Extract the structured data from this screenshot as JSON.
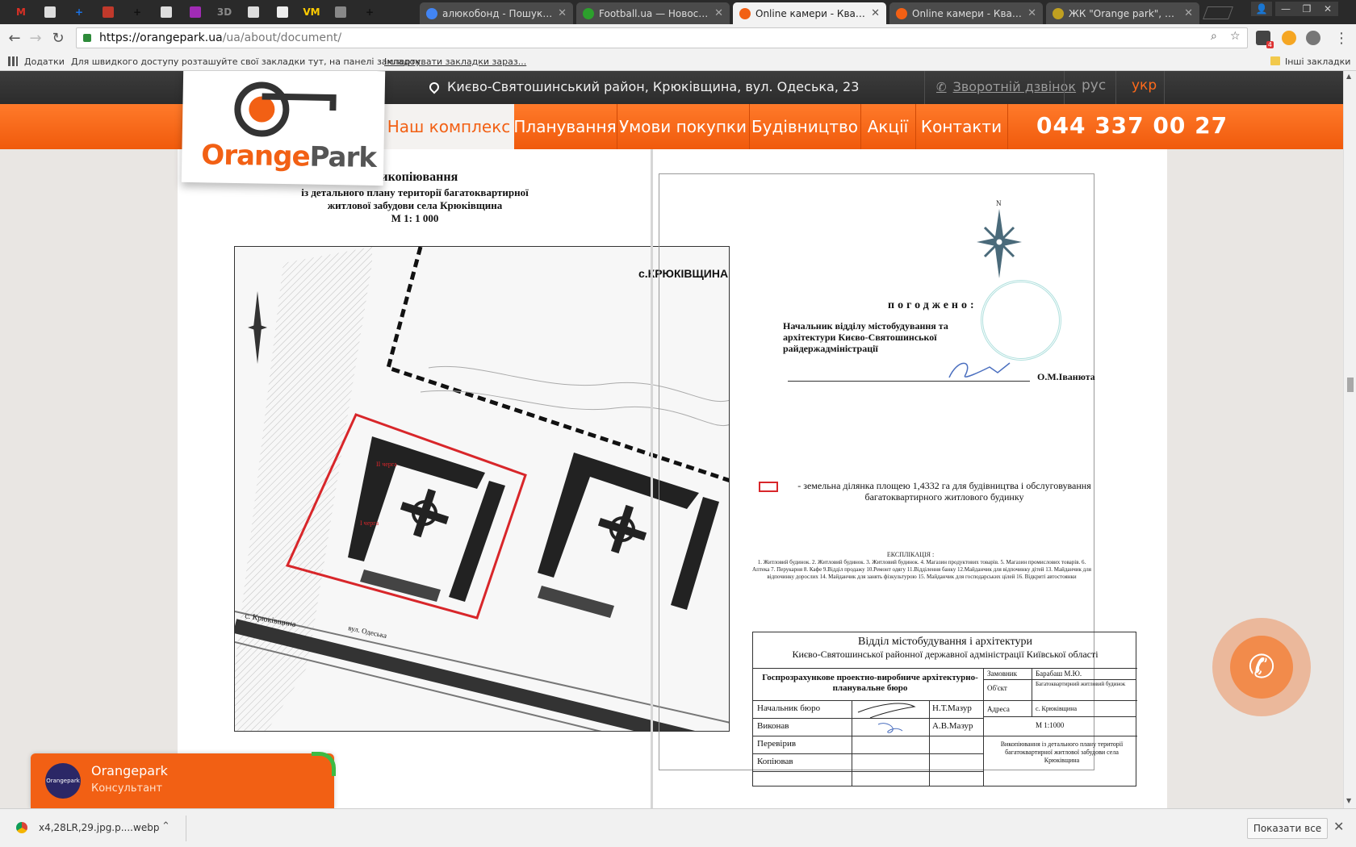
{
  "browser": {
    "pinned_tabs": [
      {
        "icon": "gmail-icon",
        "label": "M",
        "color": "#d93025"
      },
      {
        "icon": "file-icon",
        "label": "",
        "color": "#dddddd"
      },
      {
        "icon": "plus-icon",
        "label": "+",
        "color": "#1a73e8"
      },
      {
        "icon": "red-site-icon",
        "label": "",
        "color": "#c0392b"
      },
      {
        "icon": "cross-icon",
        "label": "+",
        "color": "#111111"
      },
      {
        "icon": "file-icon",
        "label": "",
        "color": "#dddddd"
      },
      {
        "icon": "purple-icon",
        "label": "",
        "color": "#a12bb5"
      },
      {
        "icon": "3d-icon",
        "label": "3D",
        "color": "#888888"
      },
      {
        "icon": "file-icon",
        "label": "",
        "color": "#dddddd"
      },
      {
        "icon": "github-icon",
        "label": "",
        "color": "#eeeeee"
      },
      {
        "icon": "vm-icon",
        "label": "VM",
        "color": "#ffcc00"
      },
      {
        "icon": "speaker-icon",
        "label": "",
        "color": "#888888"
      },
      {
        "icon": "cross-icon",
        "label": "+",
        "color": "#111111"
      }
    ],
    "tabs": [
      {
        "title": "алюкобонд - Пошук Googl",
        "favicon_color": "#4285f4",
        "active": false
      },
      {
        "title": "Football.ua — Новости фу",
        "favicon_color": "#2ca02c",
        "active": false
      },
      {
        "title": "Online камери - Квартир",
        "favicon_color": "#f26014",
        "active": true
      },
      {
        "title": "Online камери - Квартир",
        "favicon_color": "#f26014",
        "active": false
      },
      {
        "title": "ЖК \"Orange park\", Крюко",
        "favicon_color": "#c0a020",
        "active": false
      }
    ],
    "url_host": "https://orangepark.ua",
    "url_path": "/ua/about/document/",
    "bookmarks": {
      "apps_label": "Додатки",
      "hint": "Для швидкого доступу розташуйте свої закладки тут, на панелі закладок.",
      "import_link": "Імпортувати закладки зараз...",
      "other": "Інші закладки"
    },
    "extension_badge": "4"
  },
  "site": {
    "address": "Києво-Святошинський район, Крюківщина, вул. Одеська, 23",
    "callback": "Зворотній дзвінок",
    "lang_rus": "рус",
    "lang_ukr": "укр",
    "logo_text_orange": "Orange",
    "logo_text_park": "Park",
    "nav": [
      {
        "label": "Наш комплекс",
        "active": true
      },
      {
        "label": "Планування",
        "active": false
      },
      {
        "label": "Умови покупки",
        "active": false
      },
      {
        "label": "Будівництво",
        "active": false
      },
      {
        "label": "Акції",
        "active": false
      },
      {
        "label": "Контакти",
        "active": false
      }
    ],
    "phone": "044 337 00 27"
  },
  "document": {
    "title_line1": "Викопіювання",
    "title_line2": "із детального плану території багатоквартирної",
    "title_line3": "житлової забудови села Крюківщина",
    "title_line4": "М 1: 1 000",
    "map_village_label": "с.КРЮКІВЩИНА",
    "map_street_label": "с. Крюківщина",
    "map_street2": "вул. Одеська",
    "map_queue1": "I черга",
    "map_queue2": "II черга",
    "north_label": "N",
    "approved": "погоджено:",
    "chief_text": "Начальник відділу містобудування та архітектури Києво-Святошинської райдержадміністрації",
    "signature_name": "О.М.Іванюта",
    "legend_text": "- земельна ділянка площею 1,4332 га для будівництва і обслуговування багатоквартирного житлового будинку",
    "explication_title": "ЕКСПЛІКАЦІЯ :",
    "explication_text": "1. Житловий будинок. 2. Житловий будинок. 3. Житловий будинок. 4. Магазин продуктових товарів. 5. Магазин промислових товарів. 6. Аптека 7. Перукарня 8. Кафе 9.Відділ продажу 10.Ремонт одягу 11.Відділення банку 12.Майданчик для відпочинку дітей 13. Майданчик для відпочинку дорослих 14. Майданчик для занять фізкультурою 15. Майданчик для господарських цілей 16. Відкриті автостоянки",
    "stamp": {
      "header1": "Відділ містобудування і архітектури",
      "header2": "Києво-Святошинської районної державної адміністрації Київської області",
      "org": "Госпрозрахункове проектно-виробниче архітектурно-планувальне бюро",
      "customer_label": "Замовник",
      "customer_value": "Барабаш М.Ю.",
      "object_label": "Об'єкт",
      "object_value": "Багатоквартирний житловий будинок",
      "address_label": "Адреса",
      "address_value": "с. Крюківщина",
      "scale_value": "М 1:1000",
      "rows": [
        {
          "role": "Начальник бюро",
          "name": "Н.Т.Мазур"
        },
        {
          "role": "Виконав",
          "name": "А.В.Мазур"
        },
        {
          "role": "Перевірив",
          "name": ""
        },
        {
          "role": "Копіював",
          "name": ""
        }
      ],
      "footer": "Викопіювання із детального плану території багатоквартирної житлової забудови села Крюківщина"
    }
  },
  "widget": {
    "name": "Orangepark",
    "role": "Консультант",
    "avatar_text": "Orangepark"
  },
  "shelf": {
    "file": "x4,28LR,29.jpg.p....webp",
    "show_all": "Показати все"
  }
}
